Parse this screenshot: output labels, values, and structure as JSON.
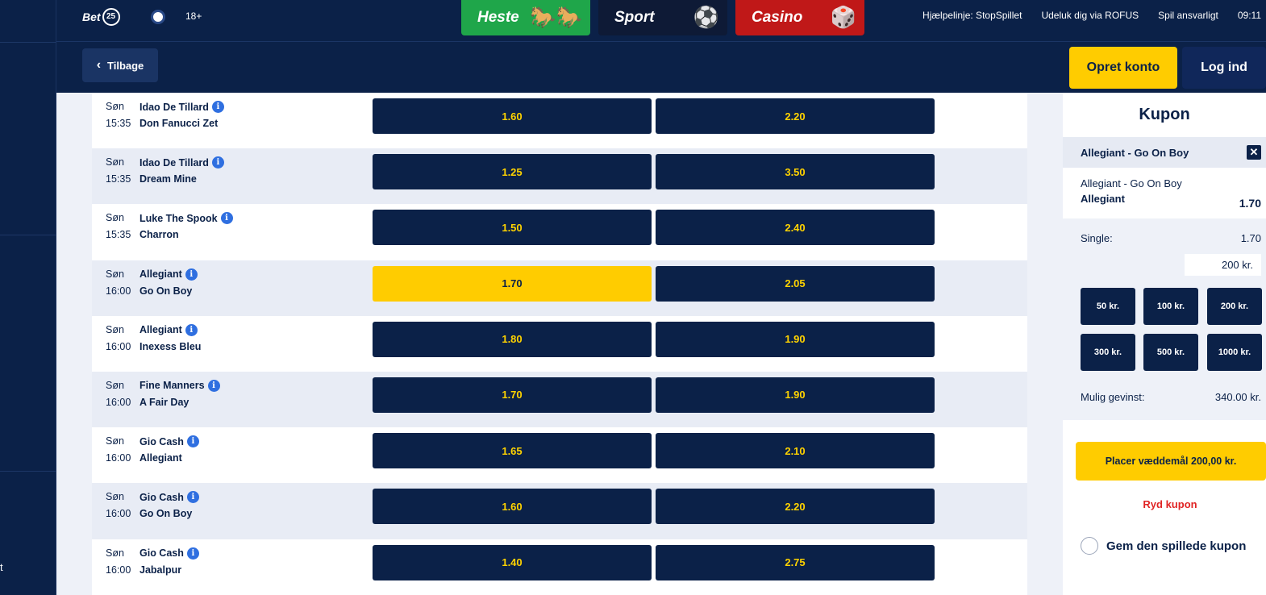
{
  "header": {
    "logo_text": "Bet",
    "logo_number": "25",
    "age": "18+",
    "nav": [
      {
        "label": "Heste",
        "icon": "horse-icon"
      },
      {
        "label": "Sport",
        "icon": "football-icon"
      },
      {
        "label": "Casino",
        "icon": "dice-icon"
      }
    ],
    "links": [
      "Hjælpelinje: StopSpillet",
      "Udeluk dig via ROFUS",
      "Spil ansvarligt",
      "09:11"
    ]
  },
  "subheader": {
    "back_label": "Tilbage",
    "signup_label": "Opret konto",
    "login_label": "Log ind"
  },
  "sidebar": {
    "partial_text": "t"
  },
  "matches": [
    {
      "day": "Søn",
      "time": "15:35",
      "home": "Idao De Tillard",
      "away": "Don Fanucci Zet",
      "odd1": "1.60",
      "odd2": "2.20",
      "selected": false
    },
    {
      "day": "Søn",
      "time": "15:35",
      "home": "Idao De Tillard",
      "away": "Dream Mine",
      "odd1": "1.25",
      "odd2": "3.50",
      "selected": false
    },
    {
      "day": "Søn",
      "time": "15:35",
      "home": "Luke The Spook",
      "away": "Charron",
      "odd1": "1.50",
      "odd2": "2.40",
      "selected": false
    },
    {
      "day": "Søn",
      "time": "16:00",
      "home": "Allegiant",
      "away": "Go On Boy",
      "odd1": "1.70",
      "odd2": "2.05",
      "selected": true
    },
    {
      "day": "Søn",
      "time": "16:00",
      "home": "Allegiant",
      "away": "Inexess Bleu",
      "odd1": "1.80",
      "odd2": "1.90",
      "selected": false
    },
    {
      "day": "Søn",
      "time": "16:00",
      "home": "Fine Manners",
      "away": "A Fair Day",
      "odd1": "1.70",
      "odd2": "1.90",
      "selected": false
    },
    {
      "day": "Søn",
      "time": "16:00",
      "home": "Gio Cash",
      "away": "Allegiant",
      "odd1": "1.65",
      "odd2": "2.10",
      "selected": false
    },
    {
      "day": "Søn",
      "time": "16:00",
      "home": "Gio Cash",
      "away": "Go On Boy",
      "odd1": "1.60",
      "odd2": "2.20",
      "selected": false
    },
    {
      "day": "Søn",
      "time": "16:00",
      "home": "Gio Cash",
      "away": "Jabalpur",
      "odd1": "1.40",
      "odd2": "2.75",
      "selected": false
    }
  ],
  "coupon": {
    "title": "Kupon",
    "header": "Allegiant - Go On Boy",
    "selection_event": "Allegiant - Go On Boy",
    "selection_pick": "Allegiant",
    "selection_odds": "1.70",
    "single_label": "Single:",
    "single_odds": "1.70",
    "stake_value": "200 kr.",
    "chips": [
      "50 kr.",
      "100 kr.",
      "200 kr.",
      "300 kr.",
      "500 kr.",
      "1000 kr."
    ],
    "win_label": "Mulig gevinst:",
    "win_value": "340.00 kr.",
    "place_label": "Placer væddemål 200,00 kr.",
    "clear_label": "Ryd kupon",
    "save_label": "Gem den spillede kupon"
  },
  "colors": {
    "navy": "#0b2148",
    "yellow": "#ffcc00",
    "odd_text": "#ffd300",
    "heste_green": "#1fa64a",
    "casino_red": "#c01818",
    "info_blue": "#2f6fe0",
    "clear_red": "#e02424"
  }
}
